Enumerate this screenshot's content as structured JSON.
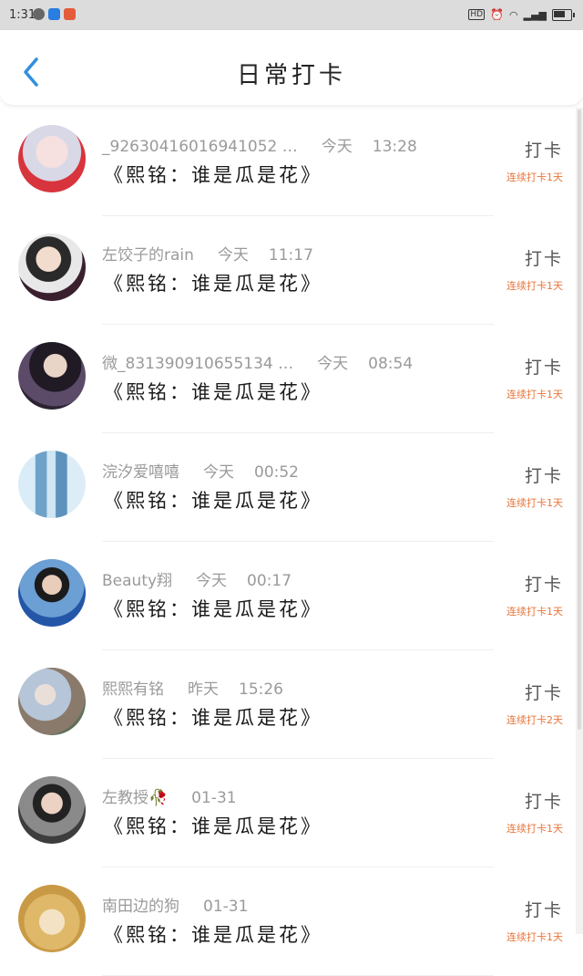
{
  "status_bar": {
    "time": "1:31"
  },
  "header": {
    "title": "日常打卡"
  },
  "entries": [
    {
      "name": "_92630416016941052 …",
      "date": "今天",
      "time": "13:28",
      "content": "《熙铭：谁是瓜是花》",
      "action": "打卡",
      "streak": "连续打卡1天"
    },
    {
      "name": "左饺子的rain",
      "date": "今天",
      "time": "11:17",
      "content": "《熙铭：谁是瓜是花》",
      "action": "打卡",
      "streak": "连续打卡1天"
    },
    {
      "name": "微_831390910655134 …",
      "date": "今天",
      "time": "08:54",
      "content": "《熙铭：谁是瓜是花》",
      "action": "打卡",
      "streak": "连续打卡1天"
    },
    {
      "name": "浣汐爱嘻嘻",
      "date": "今天",
      "time": "00:52",
      "content": "《熙铭：谁是瓜是花》",
      "action": "打卡",
      "streak": "连续打卡1天"
    },
    {
      "name": "Beauty翔",
      "date": "今天",
      "time": "00:17",
      "content": "《熙铭：谁是瓜是花》",
      "action": "打卡",
      "streak": "连续打卡1天"
    },
    {
      "name": "熙熙有铭",
      "date": "昨天",
      "time": "15:26",
      "content": "《熙铭：谁是瓜是花》",
      "action": "打卡",
      "streak": "连续打卡2天"
    },
    {
      "name": "左教授🥀",
      "date": "01-31",
      "time": "",
      "content": "《熙铭：谁是瓜是花》",
      "action": "打卡",
      "streak": "连续打卡1天"
    },
    {
      "name": "南田边的狗",
      "date": "01-31",
      "time": "",
      "content": "《熙铭：谁是瓜是花》",
      "action": "打卡",
      "streak": "连续打卡1天"
    }
  ],
  "colors": {
    "accent": "#2f8fe0",
    "streak": "#e8753a"
  }
}
